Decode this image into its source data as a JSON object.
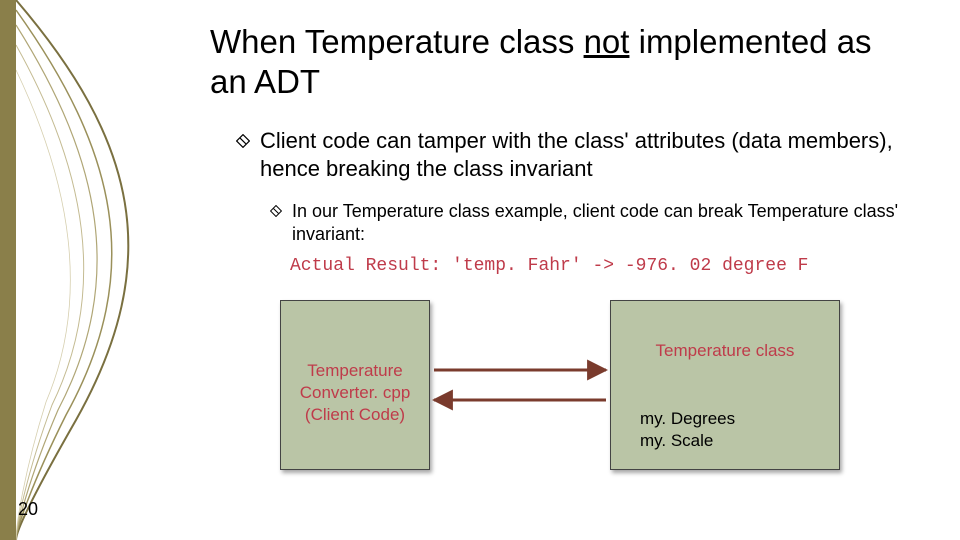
{
  "title": {
    "pre": "When Temperature class ",
    "underlined": "not",
    "post": " implemented as an ADT"
  },
  "bullet1": "Client code can tamper with the class' attributes (data members), hence breaking the class invariant",
  "bullet2": "In our Temperature class example, client code can break Temperature class' invariant:",
  "code_line": "Actual Result: 'temp. Fahr' -> -976. 02 degree F",
  "box_left_label": "Temperature Converter. cpp (Client Code)",
  "box_right_title": "Temperature class",
  "box_right_members": "my. Degrees\nmy. Scale",
  "page_number": "20"
}
